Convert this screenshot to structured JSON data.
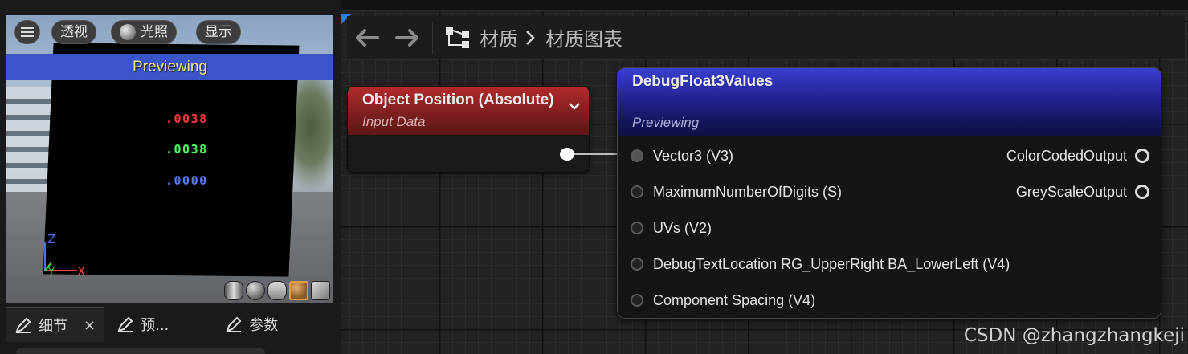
{
  "viewport": {
    "toolbar": {
      "perspective_label": "透视",
      "lit_label": "光照",
      "show_label": "显示"
    },
    "banner": "Previewing",
    "debug_values": {
      "r": ".0038",
      "g": ".0038",
      "b": ".0000"
    },
    "axis": {
      "z": "Z",
      "y": "Y",
      "x": "X"
    }
  },
  "left_tabs": [
    {
      "label": "细节",
      "active": true,
      "close": "×"
    },
    {
      "label": "预...",
      "active": false
    },
    {
      "label": "参数",
      "active": false
    }
  ],
  "graph": {
    "breadcrumb": [
      "材质",
      "材质图表"
    ],
    "nodes": {
      "object_position": {
        "title": "Object Position (Absolute)",
        "subtitle": "Input Data"
      },
      "debug": {
        "title": "DebugFloat3Values",
        "subtitle": "Previewing",
        "inputs": [
          "Vector3 (V3)",
          "MaximumNumberOfDigits (S)",
          "UVs (V2)",
          "DebugTextLocation RG_UpperRight BA_LowerLeft (V4)",
          "Component Spacing (V4)"
        ],
        "outputs": [
          "ColorCodedOutput",
          "GreyScaleOutput"
        ]
      }
    }
  },
  "watermark": "CSDN @zhangzhangkeji",
  "colors": {
    "banner": "#3a55c8",
    "op_header": "#b32a2a",
    "debug_header": "#22238f",
    "debug_r": "#ff3b3b",
    "debug_g": "#4dff5e",
    "debug_b": "#5b7bff"
  }
}
